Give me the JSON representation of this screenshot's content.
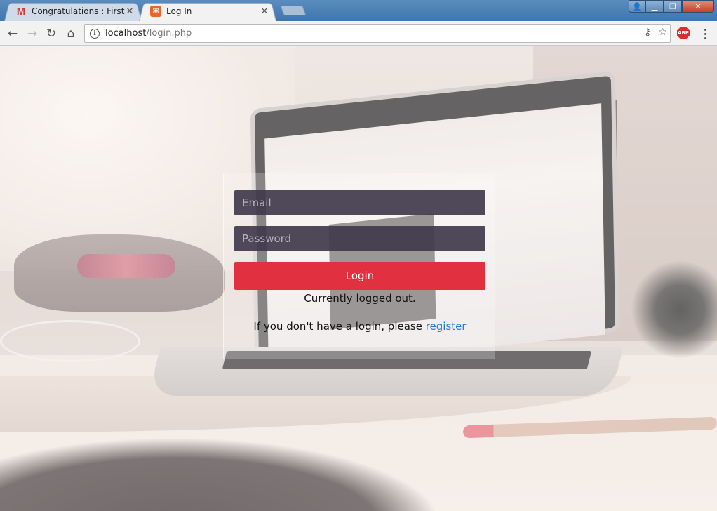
{
  "browser": {
    "tabs": [
      {
        "title": "Congratulations : First Ro",
        "favicon": "gmail-icon",
        "active": false
      },
      {
        "title": "Log In",
        "favicon": "xampp-icon",
        "active": true
      }
    ],
    "close_glyph": "✕",
    "window_buttons": {
      "user": "👤",
      "minimize": "▁",
      "restore": "❐",
      "close": "✕"
    },
    "nav": {
      "back": "←",
      "forward": "→",
      "reload": "↻",
      "home": "⌂"
    },
    "address": {
      "host": "localhost",
      "path": "/login.php",
      "info": "i"
    },
    "omnibox_icons": {
      "key": "⚷",
      "star": "☆"
    },
    "extension_badge": "ABP"
  },
  "login": {
    "email_placeholder": "Email",
    "password_placeholder": "Password",
    "button_label": "Login",
    "status": "Currently logged out.",
    "register_prompt": "If you don't have a login, please ",
    "register_link": "register"
  },
  "colors": {
    "login_button": "#e1303f",
    "input_background": "#403a4c",
    "link": "#2a7bd8",
    "titlebar": "#4a80b6"
  }
}
